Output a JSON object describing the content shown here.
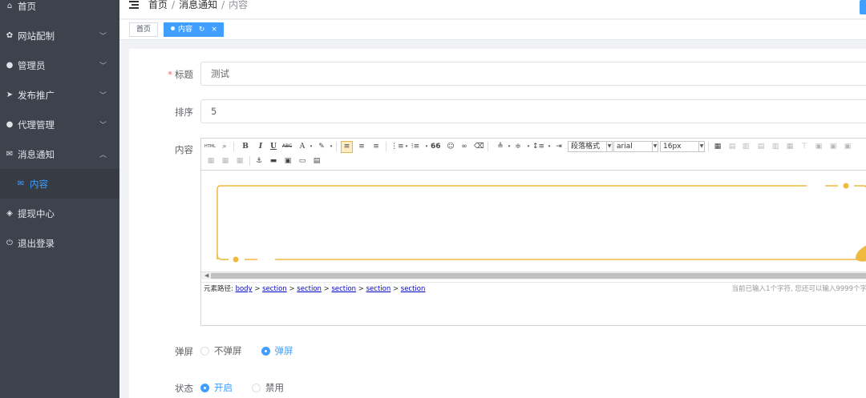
{
  "sidebar": {
    "items": [
      {
        "icon": "home-icon",
        "glyph": "⌂",
        "label": "首页",
        "arrow": ""
      },
      {
        "icon": "gear-icon",
        "glyph": "✿",
        "label": "网站配制",
        "arrow": "﹀"
      },
      {
        "icon": "user-icon",
        "glyph": "●",
        "label": "管理员",
        "arrow": "﹀"
      },
      {
        "icon": "send-icon",
        "glyph": "➤",
        "label": "发布推广",
        "arrow": "﹀"
      },
      {
        "icon": "agent-icon",
        "glyph": "●",
        "label": "代理管理",
        "arrow": "﹀"
      },
      {
        "icon": "mail-icon",
        "glyph": "✉",
        "label": "消息通知",
        "arrow": "︿"
      },
      {
        "icon": "mail-icon",
        "glyph": "✉",
        "label": "内容",
        "arrow": ""
      },
      {
        "icon": "coin-icon",
        "glyph": "◈",
        "label": "提现中心",
        "arrow": ""
      },
      {
        "icon": "power-icon",
        "glyph": "⏻",
        "label": "退出登录",
        "arrow": ""
      }
    ]
  },
  "breadcrumb": {
    "home": "首页",
    "section": "消息通知",
    "current": "内容",
    "sep": "/"
  },
  "tags": {
    "home": "首页",
    "active": "内容",
    "refresh": "↻",
    "close": "×"
  },
  "form": {
    "title_required": "*",
    "title_label": "标题",
    "title_value": "测试",
    "sort_label": "排序",
    "sort_value": "5",
    "content_label": "内容",
    "popup_label": "弹屏",
    "popup_options": [
      "不弹屏",
      "弹屏"
    ],
    "popup_selected": 1,
    "status_label": "状态",
    "status_options": [
      "开启",
      "禁用"
    ],
    "status_selected": 0
  },
  "editor": {
    "toolbar": {
      "html": "HTML",
      "bold": "B",
      "italic": "I",
      "underline": "U",
      "strike": "ABC",
      "fontcolor": "A",
      "quote": "66",
      "paragraph": "段落格式",
      "font": "arial",
      "size": "16px"
    },
    "path_label": "元素路径:",
    "path": [
      "body",
      "section",
      "section",
      "section",
      "section",
      "section"
    ],
    "path_sep": ">",
    "count_text": "当前已输入1个字符, 您还可以输入9999个字"
  },
  "colors": {
    "accent": "#409eff",
    "sidebar": "#3d434d",
    "frame": "#f0b940"
  }
}
